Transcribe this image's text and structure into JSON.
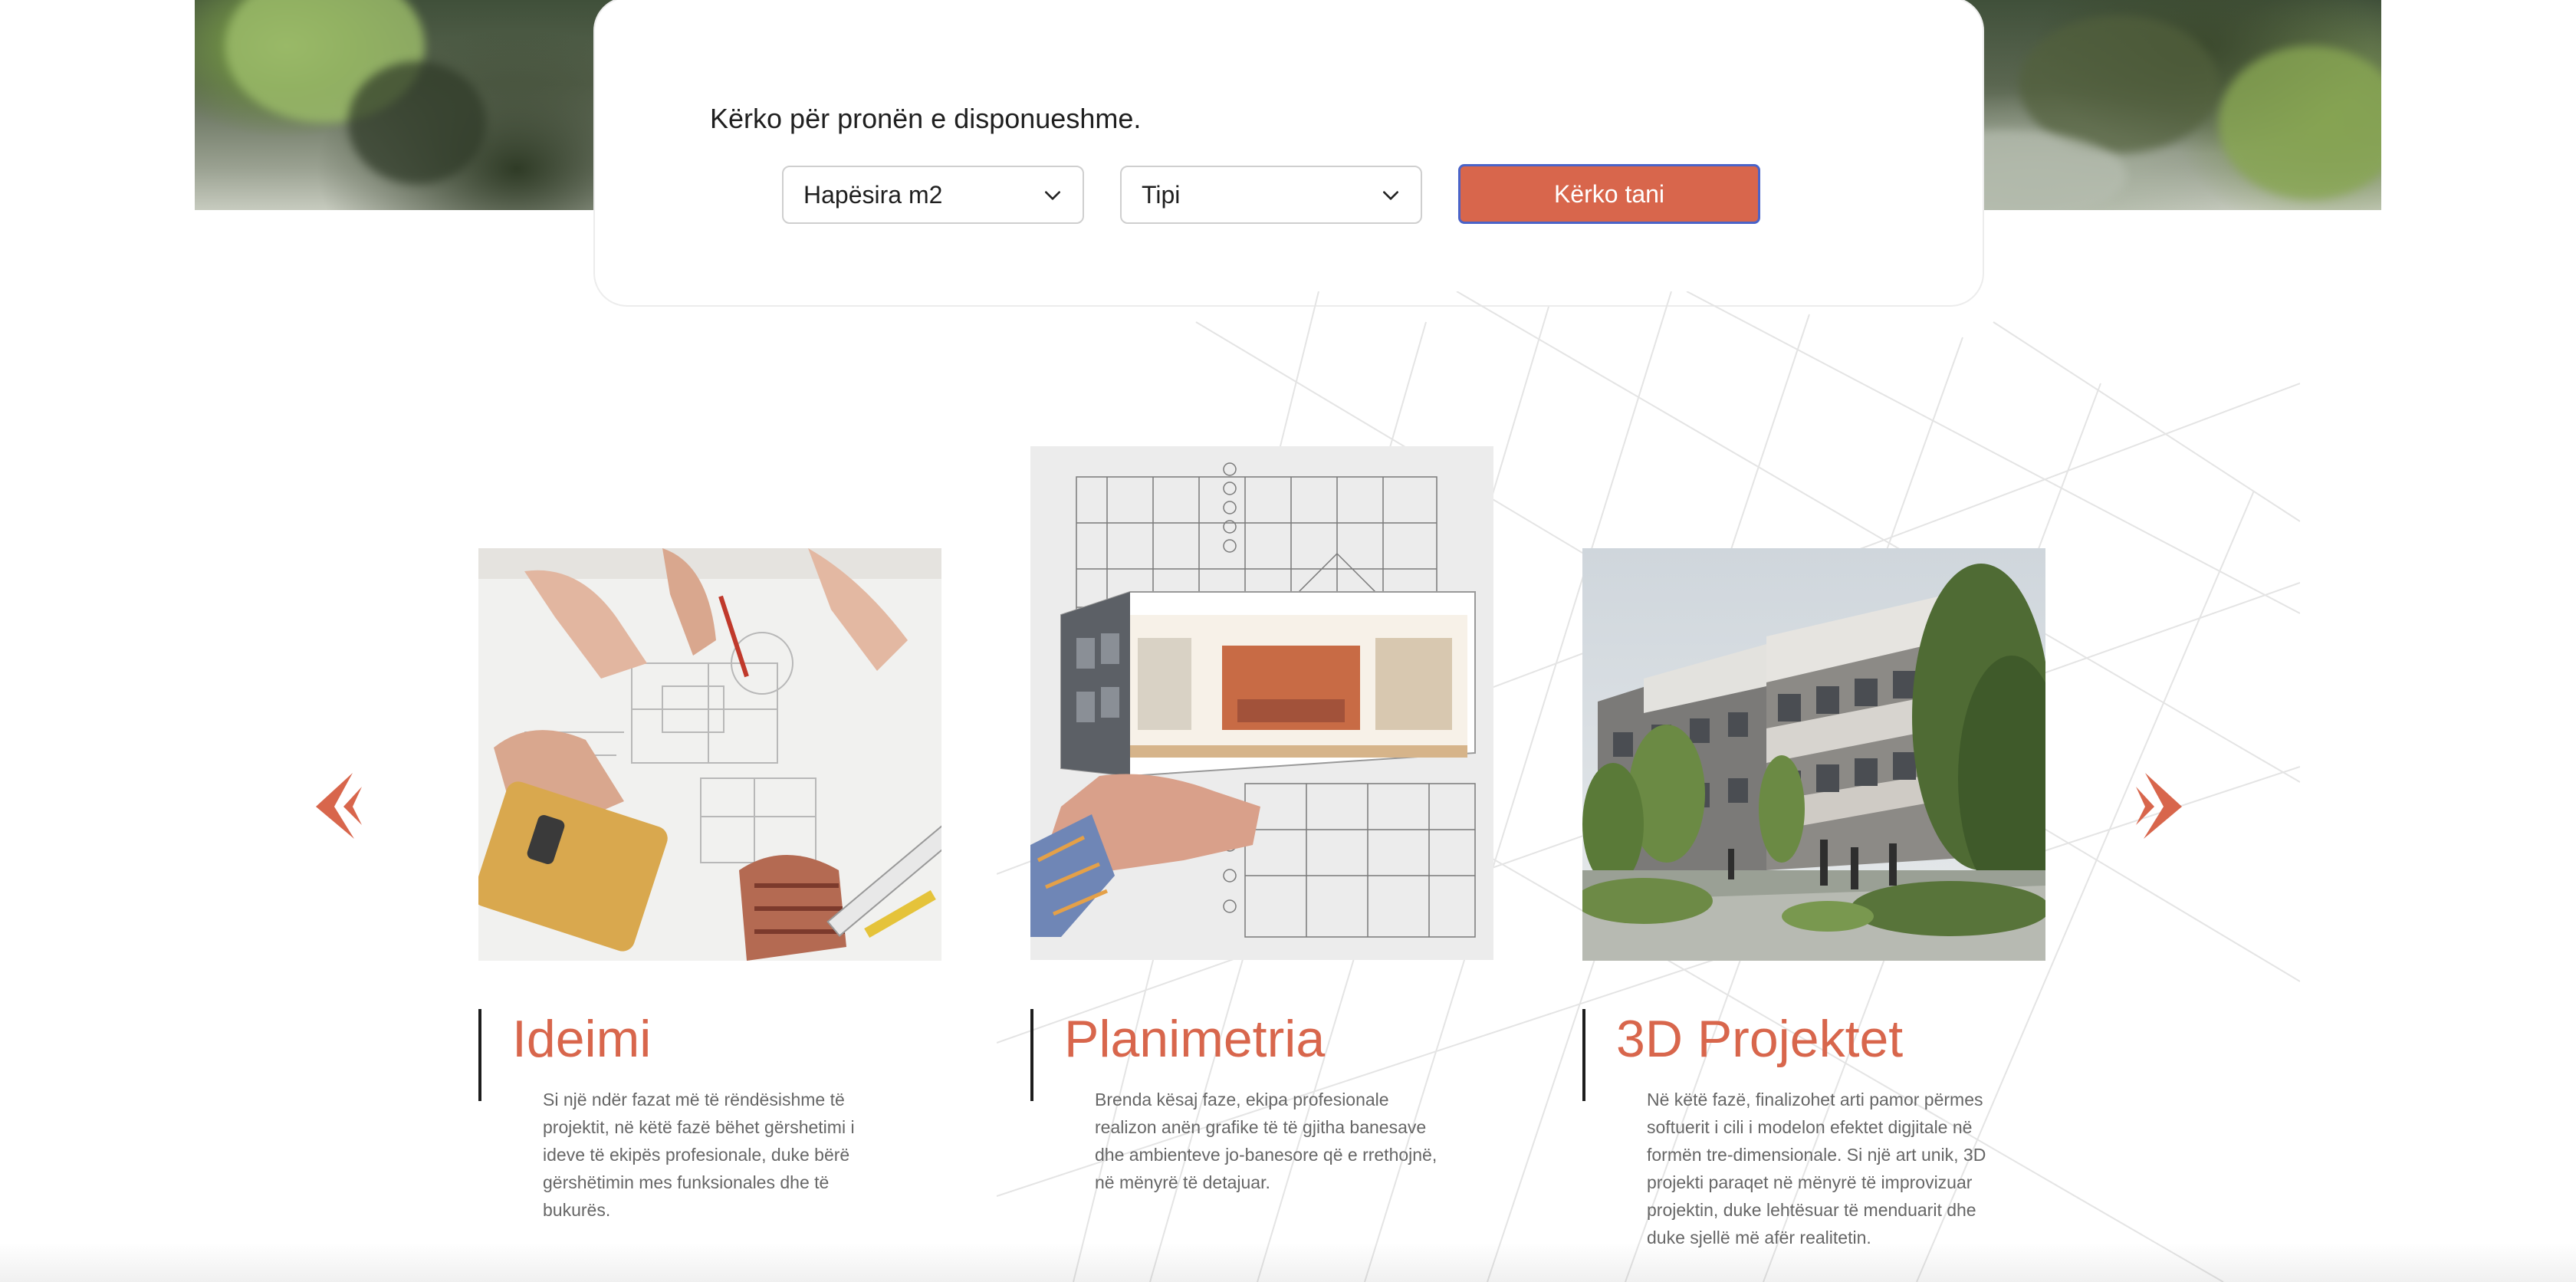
{
  "search": {
    "title": "Kërko për pronën e disponueshme.",
    "area_select": "Hapësira m2",
    "type_select": "Tipi",
    "button": "Kërko tani"
  },
  "carousel": {
    "prev_icon": "chevron-double-left-icon",
    "next_icon": "chevron-double-right-icon",
    "accent_color": "#d8664c",
    "steps": [
      {
        "title": "Ideimi",
        "image": "hands-drawing-blueprints-photo",
        "description": "Si një ndër fazat më të rëndësishme të projektit, në këtë fazë bëhet gërshetimi i ideve të ekipës profesionale, duke bërë gërshëtimin mes funksionales dhe të bukurës."
      },
      {
        "title": "Planimetria",
        "image": "hand-holding-3d-floorplan-photo",
        "description": "Brenda kësaj faze, ekipa profesionale realizon anën grafike të të gjitha banesave dhe ambienteve jo-banesore që e rrethojnë, në mënyrë të detajuar."
      },
      {
        "title": "3D Projektet",
        "image": "building-3d-render-photo",
        "description": "Në këtë fazë, finalizohet arti pamor përmes softuerit i cili i modelon efektet digjitale në formën tre-dimensionale. Si një art unik, 3D projekti paraqet në mënyrë të improvizuar projektin, duke lehtësuar të menduarit dhe duke sjellë më afër realitetin."
      }
    ]
  }
}
